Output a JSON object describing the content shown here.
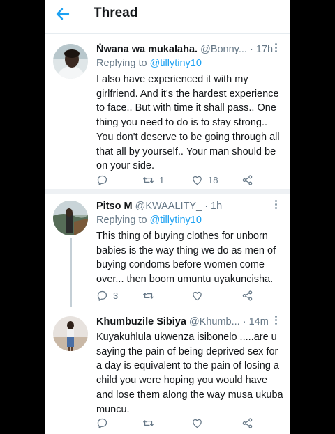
{
  "header": {
    "title": "Thread"
  },
  "tweets": [
    {
      "name": "Ṅwana wa mukalaha.",
      "handle": "@Bonny...",
      "time": "· 17h",
      "replying_prefix": "Replying to",
      "replying_handle": "@tillytiny10",
      "text": "I also have experienced it with my girlfriend. And it's the hardest experience to face.. But with time it shall pass.. One thing you need to do is to stay strong.. You don't deserve to be going through all that all by yourself.. Your man should be on your side.",
      "retweets": "1",
      "likes": "18"
    },
    {
      "name": "Pitso M",
      "handle": "@KWAALITY_",
      "time": "· 1h",
      "replying_prefix": "Replying to",
      "replying_handle": "@tillytiny10",
      "text": "This thing of buying clothes for unborn babies is the way thing we do as men of buying condoms before women come over... then boom umuntu uyakuncisha.",
      "replies": "3"
    },
    {
      "name": "Khumbuzile Sibiya",
      "handle": "@Khumb...",
      "time": "· 14m",
      "text": "Kuyakuhlula ukwenza isibonelo .....are u saying the pain of being deprived sex for a day is equivalent to the pain of losing a child you were hoping you would have and lose them along the way musa ukuba muncu."
    }
  ]
}
